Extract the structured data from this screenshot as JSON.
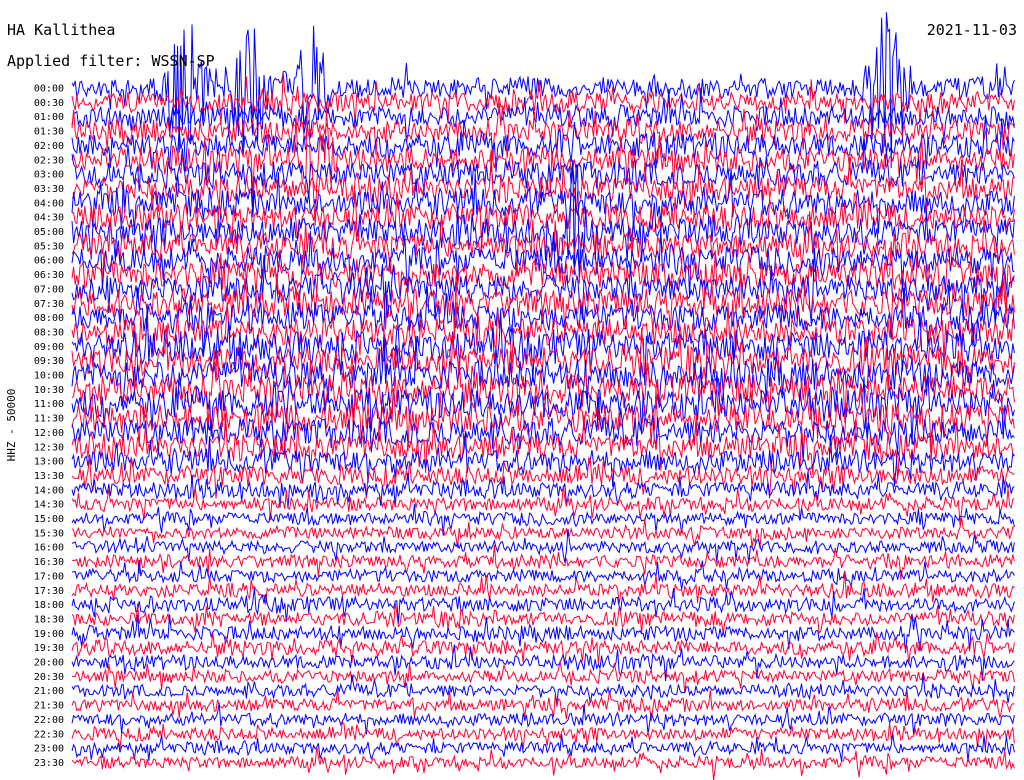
{
  "header": {
    "station": "HA Kallithea",
    "filter": "Applied filter: WSSN-SP",
    "date": "2021-11-03"
  },
  "colors": {
    "trace_a": "#0000ff",
    "trace_b": "#ff0033",
    "background": "#ffffff",
    "text": "#000000"
  },
  "chart_data": {
    "type": "line",
    "title": "HA Kallithea",
    "ylabel": "HHZ - 50000",
    "row_labels": [
      "00:00",
      "00:30",
      "01:00",
      "01:30",
      "02:00",
      "02:30",
      "03:00",
      "03:30",
      "04:00",
      "04:30",
      "05:00",
      "05:30",
      "06:00",
      "06:30",
      "07:00",
      "07:30",
      "08:00",
      "08:30",
      "09:00",
      "09:30",
      "10:00",
      "10:30",
      "11:00",
      "11:30",
      "12:00",
      "12:30",
      "13:00",
      "13:30",
      "14:00",
      "14:30",
      "15:00",
      "15:30",
      "16:00",
      "16:30",
      "17:00",
      "17:30",
      "18:00",
      "18:30",
      "19:00",
      "19:30",
      "20:00",
      "20:30",
      "21:00",
      "21:30",
      "22:00",
      "22:30",
      "23:00",
      "23:30"
    ],
    "row_minutes": 30,
    "series_colors_alternate": [
      "#0000ff",
      "#ff0033"
    ],
    "grid": false,
    "legend": "none",
    "amplitude_profile": [
      2.0,
      2.0,
      2.1,
      2.1,
      2.3,
      2.3,
      2.4,
      2.4,
      2.5,
      2.5,
      2.6,
      2.6,
      2.6,
      2.7,
      2.7,
      2.8,
      2.8,
      2.8,
      2.9,
      2.9,
      2.9,
      2.9,
      2.8,
      2.8,
      2.6,
      2.4,
      2.1,
      1.8,
      1.6,
      1.4,
      1.2,
      1.2,
      1.2,
      1.3,
      1.3,
      1.3,
      1.4,
      1.4,
      1.4,
      1.4,
      1.3,
      1.2,
      1.2,
      1.2,
      1.2,
      1.2,
      1.2,
      1.2
    ],
    "spike_events": [
      {
        "row": 0,
        "minute": 3.6,
        "strength": 0.9
      },
      {
        "row": 0,
        "minute": 5.5,
        "strength": 0.8
      },
      {
        "row": 0,
        "minute": 7.6,
        "strength": 0.7
      },
      {
        "row": 0,
        "minute": 25.9,
        "strength": 1.0
      },
      {
        "row": 5,
        "minute": 7.6,
        "strength": 0.8
      },
      {
        "row": 10,
        "minute": 16.0,
        "strength": 0.6
      }
    ]
  }
}
